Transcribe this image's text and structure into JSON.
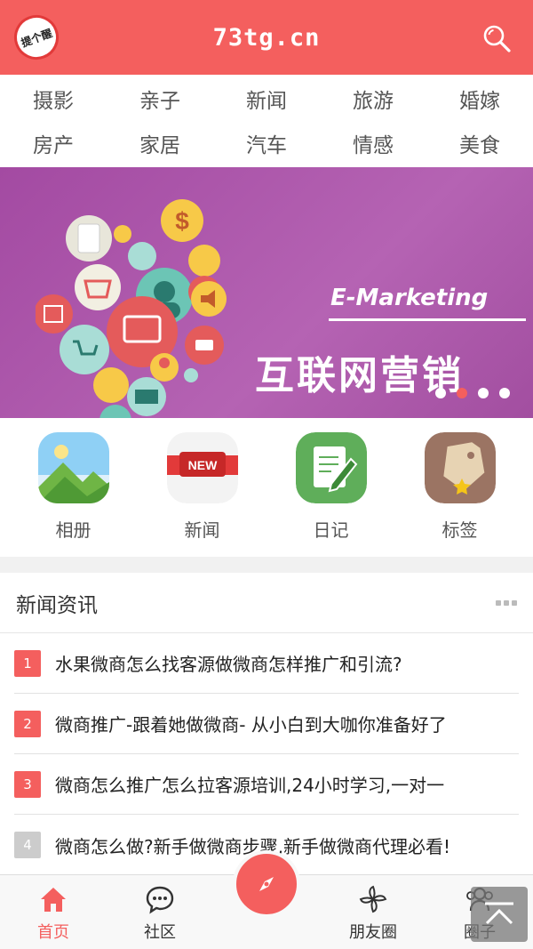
{
  "header": {
    "logo_text": "提个醒",
    "title": "73tg.cn"
  },
  "categories": [
    "摄影",
    "亲子",
    "新闻",
    "旅游",
    "婚嫁",
    "房产",
    "家居",
    "汽车",
    "情感",
    "美食"
  ],
  "banner": {
    "em_text": "E-Marketing",
    "big_text": "互联网营销",
    "active_page": 2,
    "total_pages": 4
  },
  "quick_icons": [
    {
      "label": "相册"
    },
    {
      "label": "新闻",
      "badge": "NEW"
    },
    {
      "label": "日记"
    },
    {
      "label": "标签"
    }
  ],
  "news": {
    "title": "新闻资讯",
    "items": [
      {
        "num": "1",
        "text": "水果微商怎么找客源做微商怎样推广和引流?"
      },
      {
        "num": "2",
        "text": "微商推广-跟着她做微商- 从小白到大咖你准备好了"
      },
      {
        "num": "3",
        "text": "微商怎么推广怎么拉客源培训,24小时学习,一对一"
      },
      {
        "num": "4",
        "text": "微商怎么做?新手做微商步骤,新手做微商代理必看!"
      }
    ]
  },
  "tabbar": {
    "items": [
      "首页",
      "社区",
      "朋友圈",
      "圈子"
    ],
    "active": "首页"
  },
  "colors": {
    "accent": "#f45f5e"
  }
}
